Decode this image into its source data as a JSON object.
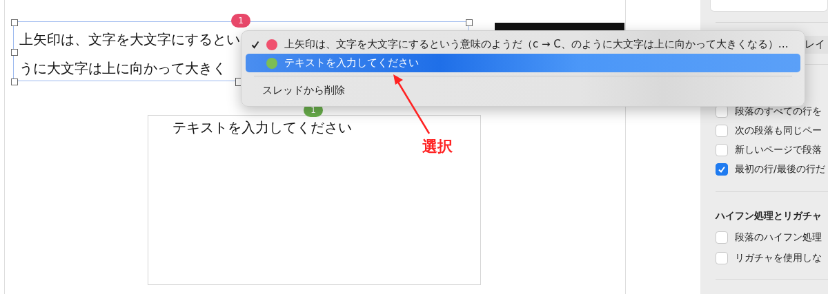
{
  "document": {
    "text_boxes": [
      {
        "lines": [
          "上矢印は、文字を大文字にするとい",
          "うに大文字は上に向かって大きく"
        ],
        "badge": "1",
        "color": "#e8486a",
        "selected": true
      },
      {
        "lines": [
          "テキストを入力してください"
        ],
        "badge": "1",
        "color": "#6ab04c",
        "selected": false
      }
    ]
  },
  "thread_menu": {
    "items": [
      {
        "kind": "thread",
        "label": "上矢印は、文字を大文字にするという意味のようだ（c → C、のように大文字は上に向かって大きくなる）…",
        "color": "#f0506e",
        "checked": true,
        "selected": false
      },
      {
        "kind": "thread",
        "label": "テキストを入力してください",
        "color": "#7dbd55",
        "checked": false,
        "selected": true
      },
      {
        "kind": "separator"
      },
      {
        "kind": "action",
        "label": "スレッドから削除",
        "selected": false
      }
    ]
  },
  "sidebar": {
    "layout_button": "レイ",
    "options": [
      {
        "label": "段落のすべての行を",
        "checked": false
      },
      {
        "label": "次の段落も同じペー",
        "checked": false
      },
      {
        "label": "新しいページで段落",
        "checked": false
      },
      {
        "label": "最初の行/最後の行だ",
        "checked": true
      }
    ],
    "hyphenation": {
      "heading": "ハイフン処理とリガチャ",
      "options": [
        {
          "label": "段落のハイフン処理",
          "checked": false
        },
        {
          "label": "リガチャを使用しな",
          "checked": false
        }
      ]
    }
  },
  "annotation": {
    "label": "選択"
  }
}
